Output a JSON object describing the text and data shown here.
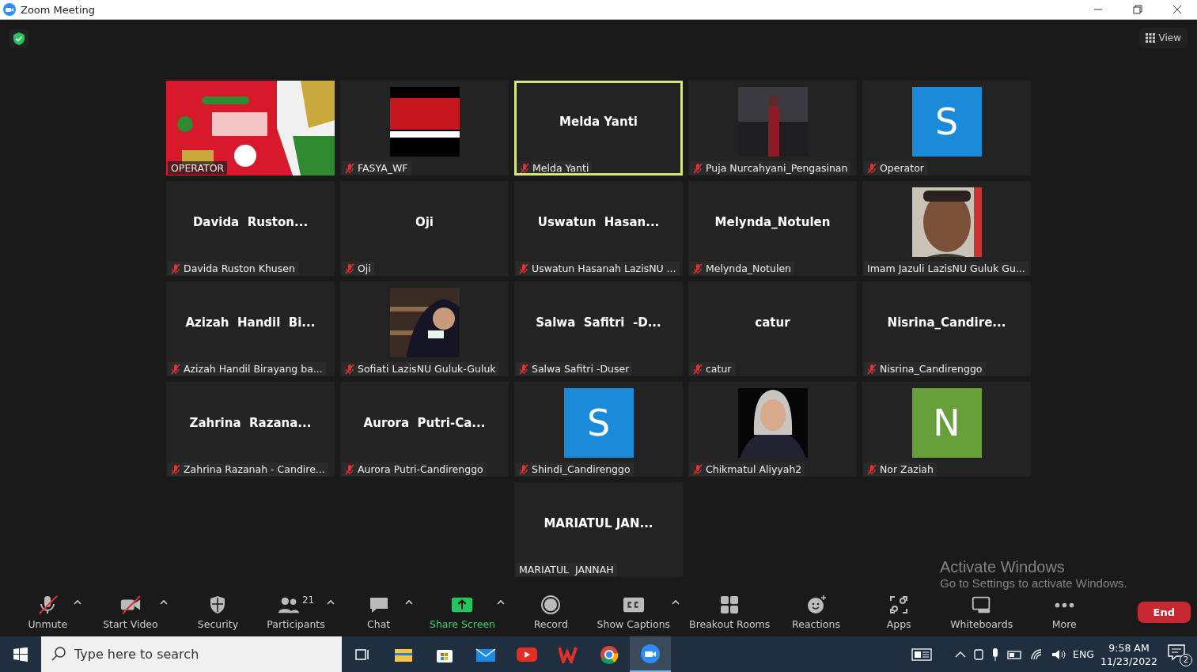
{
  "window": {
    "title": "Zoom Meeting"
  },
  "view_button": {
    "label": "View"
  },
  "tiles": [
    {
      "kind": "picture",
      "label": "OPERATOR",
      "muted": false,
      "speaking": false
    },
    {
      "kind": "picture",
      "label": "FASYA_WF",
      "muted": true,
      "speaking": false
    },
    {
      "kind": "name",
      "display": "Melda Yanti",
      "label": "Melda Yanti",
      "muted": true,
      "speaking": true
    },
    {
      "kind": "picture",
      "label": "Puja Nurcahyani_Pengasinan",
      "muted": true,
      "speaking": false
    },
    {
      "kind": "avatar",
      "letter": "S",
      "color": "#1b8ad8",
      "label": "Operator",
      "muted": true,
      "speaking": false
    },
    {
      "kind": "name",
      "display": "Davida  Ruston...",
      "label": "Davida Ruston Khusen",
      "muted": true,
      "speaking": false
    },
    {
      "kind": "name",
      "display": "Oji",
      "label": "Oji",
      "muted": true,
      "speaking": false
    },
    {
      "kind": "name",
      "display": "Uswatun  Hasan...",
      "label": "Uswatun Hasanah LazisNU ...",
      "muted": true,
      "speaking": false
    },
    {
      "kind": "name",
      "display": "Melynda_Notulen",
      "label": "Melynda_Notulen",
      "muted": true,
      "speaking": false
    },
    {
      "kind": "picture",
      "label": "Imam Jazuli LazisNU Guluk Gu...",
      "muted": false,
      "speaking": false
    },
    {
      "kind": "name",
      "display": "Azizah  Handil  Bi...",
      "label": "Azizah Handil Birayang ba...",
      "muted": true,
      "speaking": false
    },
    {
      "kind": "picture",
      "label": "Sofiati LazisNU Guluk-Guluk",
      "muted": true,
      "speaking": false
    },
    {
      "kind": "name",
      "display": "Salwa  Safitri  -D...",
      "label": "Salwa Safitri -Duser",
      "muted": true,
      "speaking": false
    },
    {
      "kind": "name",
      "display": "catur",
      "label": "catur",
      "muted": true,
      "speaking": false
    },
    {
      "kind": "name",
      "display": "Nisrina_Candire...",
      "label": "Nisrina_Candirenggo",
      "muted": true,
      "speaking": false
    },
    {
      "kind": "name",
      "display": "Zahrina  Razana...",
      "label": "Zahrina Razanah - Candire...",
      "muted": true,
      "speaking": false
    },
    {
      "kind": "name",
      "display": "Aurora  Putri-Ca...",
      "label": "Aurora Putri-Candirenggo",
      "muted": true,
      "speaking": false
    },
    {
      "kind": "avatar",
      "letter": "S",
      "color": "#1b8ad8",
      "label": "Shindi_Candirenggo",
      "muted": true,
      "speaking": false
    },
    {
      "kind": "picture",
      "label": "Chikmatul Aliyyah2",
      "muted": true,
      "speaking": false
    },
    {
      "kind": "avatar",
      "letter": "N",
      "color": "#67a03a",
      "label": "Nor Zaziah",
      "muted": true,
      "speaking": false
    },
    {
      "kind": "name",
      "display": "MARIATUL JAN...",
      "label": "MARIATUL  JANNAH",
      "muted": false,
      "speaking": false
    }
  ],
  "toolbar": [
    {
      "label": "Unmute",
      "off": true,
      "menu": true,
      "highlighted": false
    },
    {
      "label": "Start Video",
      "off": true,
      "menu": true,
      "highlighted": false
    },
    {
      "label": "Security",
      "off": false,
      "menu": false,
      "highlighted": false
    },
    {
      "label": "Participants",
      "count": "21",
      "off": false,
      "menu": true,
      "highlighted": false
    },
    {
      "label": "Chat",
      "off": false,
      "menu": true,
      "highlighted": false
    },
    {
      "label": "Share Screen",
      "off": false,
      "menu": true,
      "highlighted": true
    },
    {
      "label": "Record",
      "off": false,
      "menu": false,
      "highlighted": false
    },
    {
      "label": "Show Captions",
      "off": false,
      "menu": true,
      "highlighted": false
    },
    {
      "label": "Breakout Rooms",
      "off": false,
      "menu": false,
      "highlighted": false
    },
    {
      "label": "Reactions",
      "off": false,
      "menu": false,
      "highlighted": false
    },
    {
      "label": "Apps",
      "off": false,
      "menu": false,
      "highlighted": false
    },
    {
      "label": "Whiteboards",
      "off": false,
      "menu": false,
      "highlighted": false
    },
    {
      "label": "More",
      "off": false,
      "menu": false,
      "highlighted": false
    }
  ],
  "end_button": {
    "label": "End"
  },
  "activation_notice": {
    "title": "Activate Windows",
    "text": "Go to Settings to activate Windows."
  },
  "taskbar": {
    "search": {
      "placeholder": "Type here to search"
    },
    "language": "ENG",
    "time": "9:58 AM",
    "date": "11/23/2022",
    "notifications": "2"
  }
}
